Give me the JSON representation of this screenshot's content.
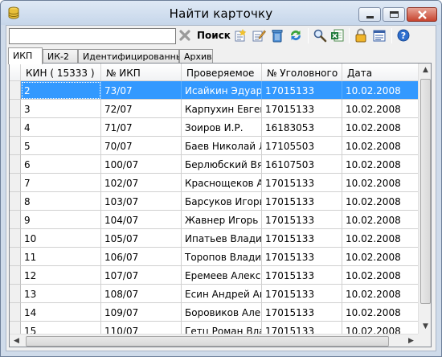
{
  "window": {
    "title": "Найти карточку"
  },
  "toolbar": {
    "search_value": "",
    "search_label": "Поиск",
    "icons": [
      "clear-icon",
      "new-card-icon",
      "edit-card-icon",
      "delete-icon",
      "refresh-icon",
      "find-icon",
      "excel-export-icon",
      "lock-icon",
      "card-list-icon",
      "help-icon"
    ]
  },
  "tabs": [
    {
      "label": "ИКП",
      "active": true
    },
    {
      "label": "ИК-2",
      "active": false
    },
    {
      "label": "Идентифицированные",
      "active": false
    },
    {
      "label": "Архив",
      "active": false
    }
  ],
  "grid": {
    "columns": [
      "КИН  ( 15333 )",
      "№ ИКП",
      "Проверяемое",
      "№ Уголовного",
      "Дата"
    ],
    "rows": [
      [
        "2",
        "73/07",
        "Исайкин Эдуард...",
        "17015133",
        "10.02.2008"
      ],
      [
        "3",
        "72/07",
        "Карпухин Евген...",
        "17015133",
        "10.02.2008"
      ],
      [
        "4",
        "71/07",
        "Зоиров И.Р.",
        "16183053",
        "10.02.2008"
      ],
      [
        "5",
        "70/07",
        "Баев Николай Л...",
        "17105503",
        "10.02.2008"
      ],
      [
        "6",
        "100/07",
        "Берлюбский Вя...",
        "16107503",
        "10.02.2008"
      ],
      [
        "7",
        "102/07",
        "Краснощеков А...",
        "17015133",
        "10.02.2008"
      ],
      [
        "8",
        "103/07",
        "Барсуков Игорь...",
        "17015133",
        "10.02.2008"
      ],
      [
        "9",
        "104/07",
        "Жавнер Игорь ...",
        "17015133",
        "10.02.2008"
      ],
      [
        "10",
        "105/07",
        "Ипатьев Влади...",
        "17015133",
        "10.02.2008"
      ],
      [
        "11",
        "106/07",
        "Торопов Влади...",
        "17015133",
        "10.02.2008"
      ],
      [
        "12",
        "107/07",
        "Еремеев Алекс...",
        "17015133",
        "10.02.2008"
      ],
      [
        "13",
        "108/07",
        "Есин Андрей Ан...",
        "17015133",
        "10.02.2008"
      ],
      [
        "14",
        "109/07",
        "Боровиков Алекс...",
        "17015133",
        "10.02.2008"
      ],
      [
        "15",
        "110/07",
        "Гетц Роман Вла...",
        "17015133",
        "10.02.2008"
      ]
    ],
    "selected_row": 0
  },
  "colors": {
    "selection": "#3399ff",
    "titlebar": "#cfdbea"
  }
}
